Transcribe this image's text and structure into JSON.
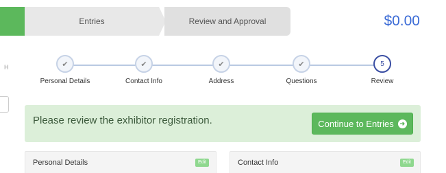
{
  "topbar": {
    "steps": [
      "Entries",
      "Review and Approval"
    ],
    "total": "$0.00"
  },
  "left_fragment": "H",
  "progress": {
    "steps": [
      {
        "label": "Personal Details",
        "icon": "check-icon",
        "state": "done"
      },
      {
        "label": "Contact Info",
        "icon": "check-icon",
        "state": "done"
      },
      {
        "label": "Address",
        "icon": "check-icon",
        "state": "done"
      },
      {
        "label": "Questions",
        "icon": "check-icon",
        "state": "done"
      },
      {
        "label": "Review",
        "number": "5",
        "state": "active"
      }
    ]
  },
  "alert": {
    "message": "Please review the exhibitor registration.",
    "button_label": "Continue to Entries",
    "button_icon": "arrow-right-circle-icon"
  },
  "panels": [
    {
      "title": "Personal Details",
      "edit_label": "Edit"
    },
    {
      "title": "Contact Info",
      "edit_label": "Edit"
    }
  ],
  "colors": {
    "success": "#5cb85c",
    "price": "#3b6bd6",
    "active_step": "#3a4ea3",
    "alert_bg": "#dcefd9"
  }
}
